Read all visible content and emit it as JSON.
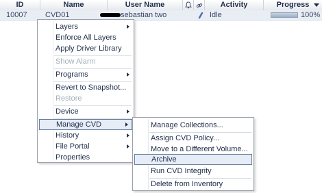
{
  "table": {
    "columns": {
      "id": "ID",
      "name": "Name",
      "user_name": "User Name",
      "activity": "Activity",
      "progress": "Progress"
    },
    "row": {
      "id": "10007",
      "name": "CVD01",
      "user_name": "sebastian two",
      "activity": "Idle",
      "progress_text": "100%",
      "progress_value": 100
    }
  },
  "context_menu": {
    "items": {
      "layers": "Layers",
      "enforce_all_layers": "Enforce All Layers",
      "apply_driver_library": "Apply Driver Library",
      "show_alarm": "Show Alarm",
      "programs": "Programs",
      "revert_to_snapshot": "Revert to Snapshot...",
      "restore": "Restore",
      "device": "Device",
      "manage_cvd": "Manage CVD",
      "history": "History",
      "file_portal": "File Portal",
      "properties": "Properties"
    }
  },
  "submenu": {
    "items": {
      "manage_collections": "Manage Collections...",
      "assign_cvd_policy": "Assign CVD Policy...",
      "move_volume": "Move to a Different Volume...",
      "archive": "Archive",
      "run_integrity": "Run CVD Integrity",
      "delete_inventory": "Delete from Inventory"
    }
  }
}
